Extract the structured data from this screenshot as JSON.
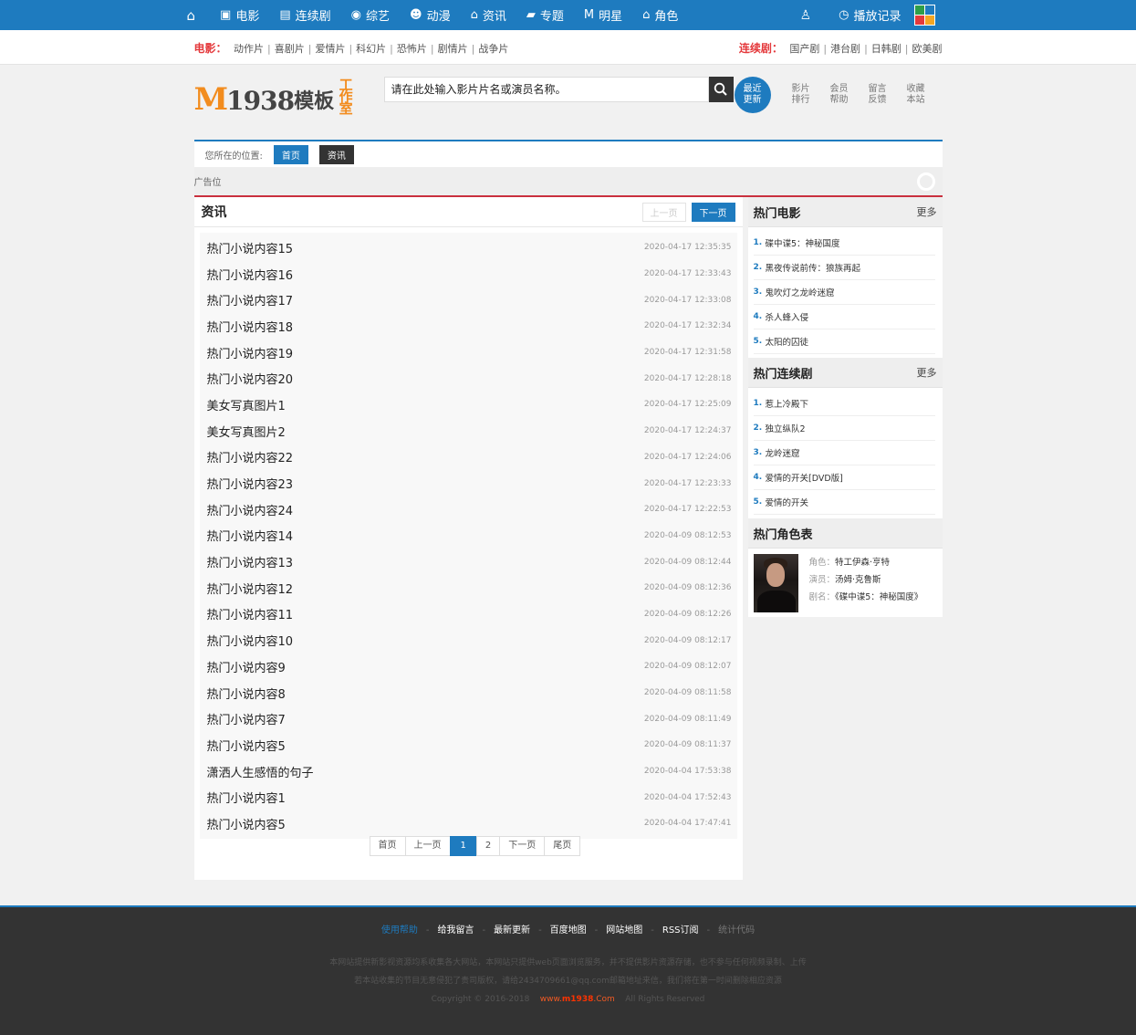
{
  "topnav": {
    "home_icon": "home-icon",
    "items": [
      {
        "label": "电影",
        "icon": "film-icon",
        "glyph": "▣"
      },
      {
        "label": "连续剧",
        "icon": "tv-icon",
        "glyph": "▤"
      },
      {
        "label": "综艺",
        "icon": "variety-icon",
        "glyph": "◉"
      },
      {
        "label": "动漫",
        "icon": "anime-icon",
        "glyph": "☻"
      },
      {
        "label": "资讯",
        "icon": "news-icon",
        "glyph": "⌂"
      },
      {
        "label": "专题",
        "icon": "topic-icon",
        "glyph": "▰"
      },
      {
        "label": "明星",
        "icon": "star-icon",
        "glyph": "M"
      },
      {
        "label": "角色",
        "icon": "role-icon",
        "glyph": "⌂"
      }
    ],
    "history_label": "播放记录",
    "brand_colors": [
      "#2e9e49",
      "#1e7bbf",
      "#e4393c",
      "#f5a623"
    ]
  },
  "catbar": {
    "movie_title": "电影：",
    "movie_cats": [
      "动作片",
      "喜剧片",
      "爱情片",
      "科幻片",
      "恐怖片",
      "剧情片",
      "战争片"
    ],
    "series_title": "连续剧：",
    "series_cats": [
      "国产剧",
      "港台剧",
      "日韩剧",
      "欧美剧"
    ]
  },
  "header": {
    "brand_m": "M",
    "brand_num": "1938",
    "brand_cn": "模板",
    "brand_studio": "工作室",
    "search_placeholder": "请在此处输入影片片名或演员名称。",
    "badge_line1": "最近",
    "badge_line2": "更新",
    "quick": [
      {
        "l1": "影片",
        "l2": "排行"
      },
      {
        "l1": "会员",
        "l2": "帮助"
      },
      {
        "l1": "留言",
        "l2": "反馈"
      },
      {
        "l1": "收藏",
        "l2": "本站"
      }
    ]
  },
  "crumb": {
    "label": "您所在的位置:",
    "home": "首页",
    "current": "资讯"
  },
  "ad": {
    "label": "广告位"
  },
  "news": {
    "title": "资讯",
    "prev": "上一页",
    "next": "下一页",
    "items": [
      {
        "t": "热门小说内容15",
        "d": "2020-04-17 12:35:35"
      },
      {
        "t": "热门小说内容16",
        "d": "2020-04-17 12:33:43"
      },
      {
        "t": "热门小说内容17",
        "d": "2020-04-17 12:33:08"
      },
      {
        "t": "热门小说内容18",
        "d": "2020-04-17 12:32:34"
      },
      {
        "t": "热门小说内容19",
        "d": "2020-04-17 12:31:58"
      },
      {
        "t": "热门小说内容20",
        "d": "2020-04-17 12:28:18"
      },
      {
        "t": "美女写真图片1",
        "d": "2020-04-17 12:25:09"
      },
      {
        "t": "美女写真图片2",
        "d": "2020-04-17 12:24:37"
      },
      {
        "t": "热门小说内容22",
        "d": "2020-04-17 12:24:06"
      },
      {
        "t": "热门小说内容23",
        "d": "2020-04-17 12:23:33"
      },
      {
        "t": "热门小说内容24",
        "d": "2020-04-17 12:22:53"
      },
      {
        "t": "热门小说内容14",
        "d": "2020-04-09 08:12:53"
      },
      {
        "t": "热门小说内容13",
        "d": "2020-04-09 08:12:44"
      },
      {
        "t": "热门小说内容12",
        "d": "2020-04-09 08:12:36"
      },
      {
        "t": "热门小说内容11",
        "d": "2020-04-09 08:12:26"
      },
      {
        "t": "热门小说内容10",
        "d": "2020-04-09 08:12:17"
      },
      {
        "t": "热门小说内容9",
        "d": "2020-04-09 08:12:07"
      },
      {
        "t": "热门小说内容8",
        "d": "2020-04-09 08:11:58"
      },
      {
        "t": "热门小说内容7",
        "d": "2020-04-09 08:11:49"
      },
      {
        "t": "热门小说内容5",
        "d": "2020-04-09 08:11:37"
      },
      {
        "t": "潇洒人生感悟的句子",
        "d": "2020-04-04 17:53:38"
      },
      {
        "t": "热门小说内容1",
        "d": "2020-04-04 17:52:43"
      },
      {
        "t": "热门小说内容5",
        "d": "2020-04-04 17:47:41"
      }
    ],
    "pager": [
      "首页",
      "上一页",
      "1",
      "2",
      "下一页",
      "尾页"
    ],
    "pager_current": "1"
  },
  "hot_movies": {
    "title": "热门电影",
    "more": "更多",
    "items": [
      "碟中谍5：神秘国度",
      "黑夜传说前传：狼族再起",
      "鬼吹灯之龙岭迷窟",
      "杀人蜂入侵",
      "太阳的囚徒"
    ]
  },
  "hot_series": {
    "title": "热门连续剧",
    "more": "更多",
    "items": [
      "惹上冷殿下",
      "独立纵队2",
      "龙岭迷窟",
      "爱情的开关[DVD版]",
      "爱情的开关"
    ]
  },
  "hot_roles": {
    "title": "热门角色表",
    "role_key": "角色：",
    "role_val": "特工伊森·亨特",
    "actor_key": "演员：",
    "actor_val": "汤姆·克鲁斯",
    "drama_key": "剧名：",
    "drama_val": "《碟中谍5：神秘国度》"
  },
  "footer": {
    "links": [
      "使用帮助",
      "给我留言",
      "最新更新",
      "百度地图",
      "网站地图",
      "RSS订阅",
      "统计代码"
    ],
    "line1": "本网站提供新影视资源均系收集各大网站，本网站只提供web页面浏览服务，并不提供影片资源存储，也不参与任何视频录制、上传",
    "line2": "若本站收集的节目无意侵犯了贵司版权，请给2434709661@qq.com邮箱地址来信，我们将在第一时间删除相应资源",
    "copy_pre": "Copyright © 2016-2018",
    "copy_site_www": "www.",
    "copy_site_dom": "m1938",
    "copy_site_com": ".Com",
    "copy_post": "All Rights Reserved"
  }
}
